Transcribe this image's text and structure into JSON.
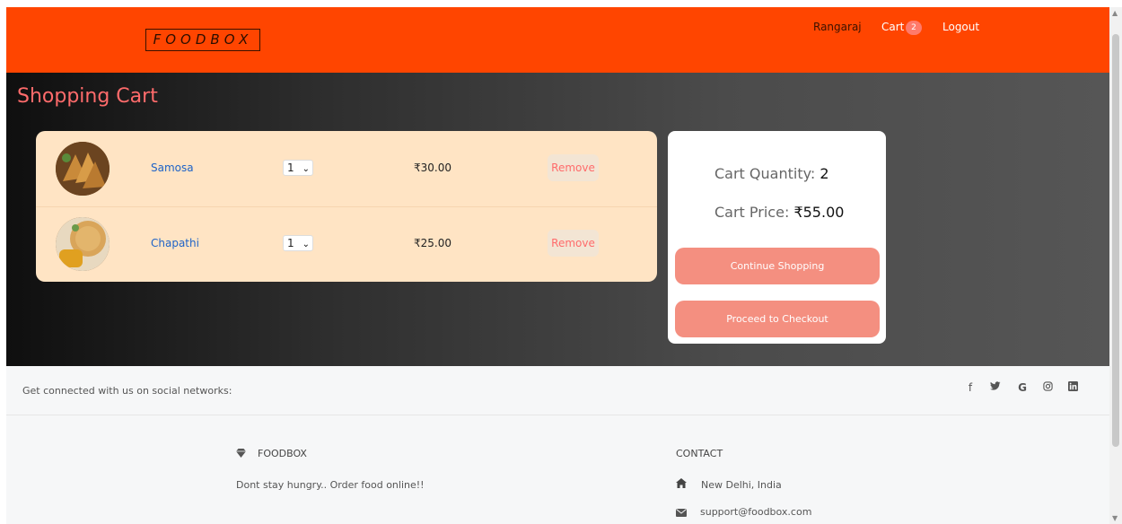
{
  "header": {
    "brand": "FOODBOX",
    "user": "Rangaraj",
    "cart_label": "Cart",
    "cart_count": "2",
    "logout": "Logout"
  },
  "page_title": "Shopping Cart",
  "cart": {
    "items": [
      {
        "name": "Samosa",
        "qty": "1",
        "price": "₹30.00",
        "remove": "Remove",
        "image": "samosa-image"
      },
      {
        "name": "Chapathi",
        "qty": "1",
        "price": "₹25.00",
        "remove": "Remove",
        "image": "chapathi-image"
      }
    ]
  },
  "summary": {
    "qty_label": "Cart Quantity:",
    "qty_value": "2",
    "price_label": "Cart Price:",
    "price_value": "₹55.00",
    "continue": "Continue Shopping",
    "checkout": "Proceed to Checkout"
  },
  "social": {
    "text": "Get connected with us on social networks:",
    "icons": [
      "facebook-icon",
      "twitter-icon",
      "google-icon",
      "instagram-icon",
      "linkedin-icon"
    ]
  },
  "footer": {
    "brand": "FOODBOX",
    "tagline": "Dont stay hungry.. Order food online!!",
    "contact_heading": "CONTACT",
    "address": "New Delhi, India",
    "email": "support@foodbox.com"
  },
  "colors": {
    "navbar": "#ff4500",
    "accent": "#ff6b6b",
    "button": "#f48f80",
    "cart_card": "#ffe4c4"
  }
}
